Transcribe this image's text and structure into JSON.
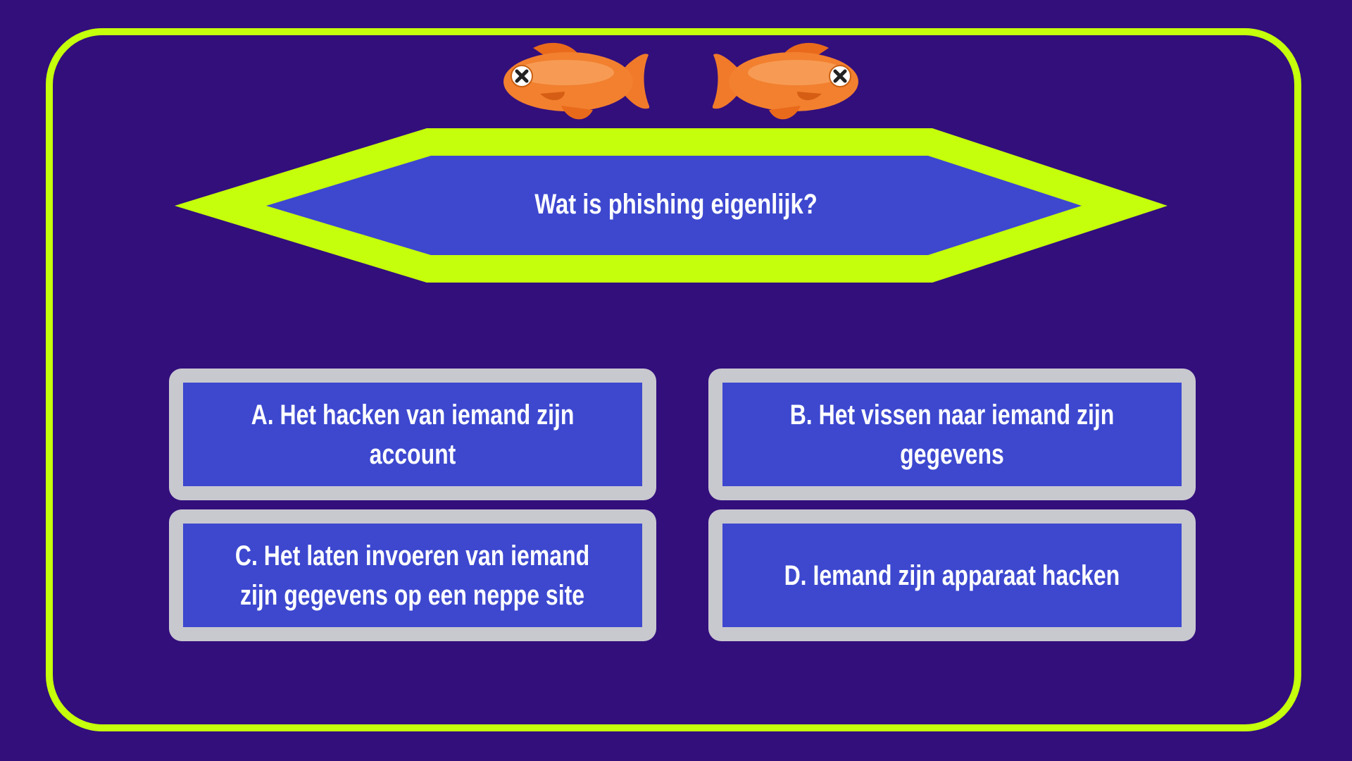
{
  "question": {
    "text": "Wat is phishing eigenlijk?"
  },
  "decorations": {
    "left_fish": "fish-icon",
    "right_fish": "fish-icon"
  },
  "answers": [
    {
      "id": "a",
      "label": "A. Het hacken van iemand zijn account"
    },
    {
      "id": "b",
      "label": "B. Het vissen naar iemand zijn gegevens"
    },
    {
      "id": "c",
      "label": "C. Het laten invoeren van iemand\nzijn gegevens op een neppe site"
    },
    {
      "id": "d",
      "label": "D. Iemand zijn apparaat hacken"
    }
  ],
  "colors": {
    "background": "#330f7c",
    "accent": "#c5ff0b",
    "panel": "#3d48cf",
    "answer_border": "#c8c8cf",
    "fish": "#f07a2a"
  }
}
